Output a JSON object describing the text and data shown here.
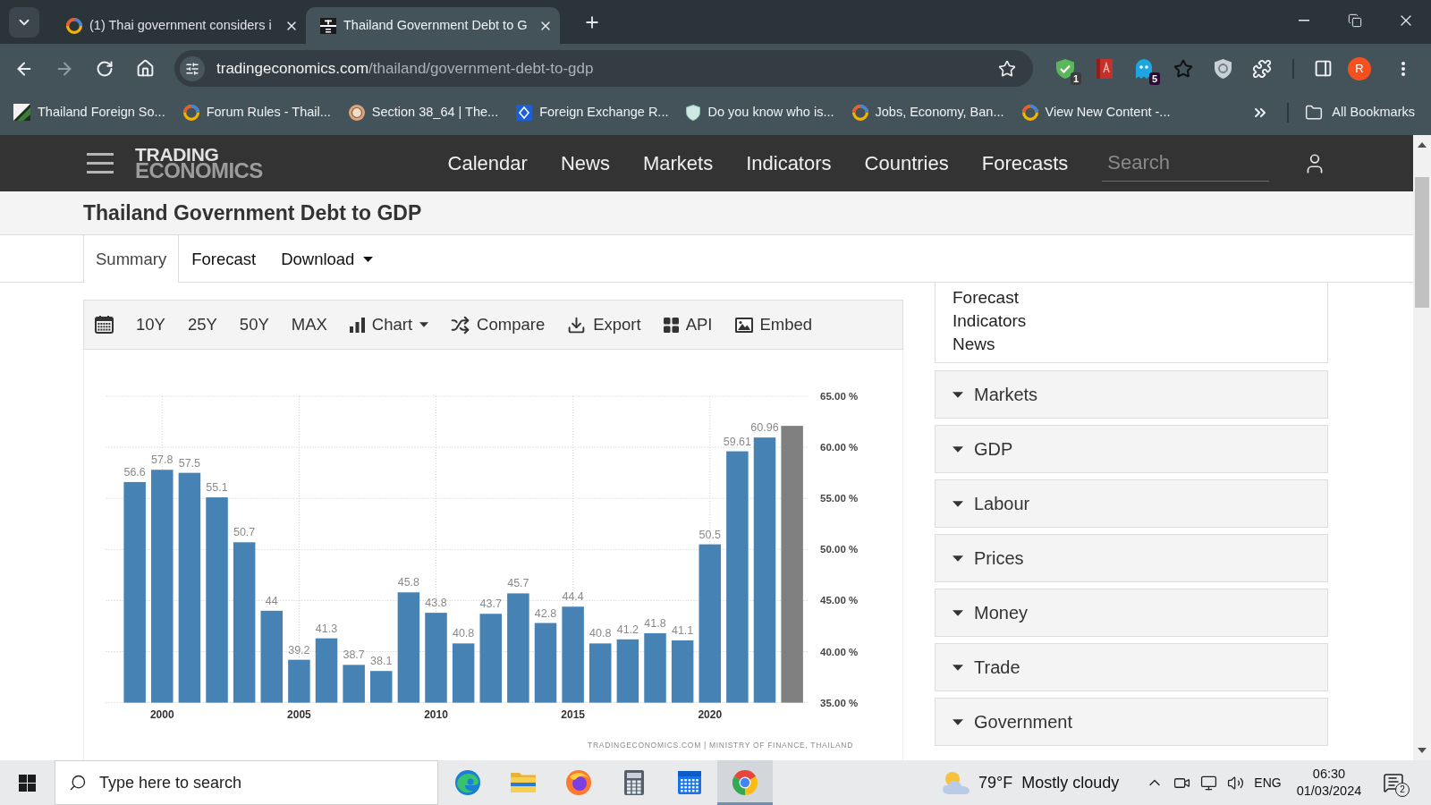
{
  "browser": {
    "tabs": [
      {
        "title": "(1) Thai government considers i",
        "kind": "ring",
        "selected": false
      },
      {
        "title": "Thailand Government Debt to G",
        "kind": "te",
        "selected": true
      }
    ],
    "address": {
      "domain": "tradingeconomics.com",
      "path": "/thailand/government-debt-to-gdp"
    },
    "extensions": [
      {
        "kind": "shield-check",
        "badge": "1"
      },
      {
        "kind": "book"
      },
      {
        "kind": "ghost",
        "badge": "5"
      },
      {
        "kind": "star"
      },
      {
        "kind": "shield"
      },
      {
        "kind": "puzzle"
      }
    ],
    "profile_initial": "R",
    "bookmarks": [
      {
        "label": "Thailand Foreign So...",
        "kind": "thumbnail"
      },
      {
        "label": "Forum Rules - Thail...",
        "kind": "ring"
      },
      {
        "label": "Section 38_64 | The...",
        "kind": "seal"
      },
      {
        "label": "Foreign Exchange R...",
        "kind": "diamond"
      },
      {
        "label": "Do you know who is...",
        "kind": "shield"
      },
      {
        "label": "Jobs, Economy, Ban...",
        "kind": "ring"
      },
      {
        "label": "View New Content -...",
        "kind": "ring"
      }
    ],
    "all_bookmarks": "All Bookmarks"
  },
  "site": {
    "logo": {
      "top": "TRADING",
      "bottom": "ECONOMICS"
    },
    "nav": [
      "Calendar",
      "News",
      "Markets",
      "Indicators",
      "Countries",
      "Forecasts"
    ],
    "search": {
      "placeholder": "Search"
    },
    "page_title": "Thailand Government Debt to GDP",
    "tabs": [
      {
        "label": "Summary",
        "selected": true
      },
      {
        "label": "Forecast",
        "selected": false
      },
      {
        "label": "Download",
        "selected": false,
        "dropdown": true
      }
    ],
    "chart_toolbar": [
      {
        "kind": "calendar"
      },
      {
        "kind": "period",
        "label": "10Y"
      },
      {
        "kind": "period",
        "label": "25Y"
      },
      {
        "kind": "period",
        "label": "50Y"
      },
      {
        "kind": "period",
        "label": "MAX"
      },
      {
        "kind": "bars",
        "label": "Chart",
        "dropdown": true
      },
      {
        "kind": "shuffle",
        "label": "Compare"
      },
      {
        "kind": "download",
        "label": "Export"
      },
      {
        "kind": "grid",
        "label": "API"
      },
      {
        "kind": "image",
        "label": "Embed"
      }
    ],
    "chart": {
      "chart_data": {
        "type": "bar",
        "x": [
          1999,
          2000,
          2001,
          2002,
          2003,
          2004,
          2005,
          2006,
          2007,
          2008,
          2009,
          2010,
          2011,
          2012,
          2013,
          2014,
          2015,
          2016,
          2017,
          2018,
          2019,
          2020,
          2021,
          2022,
          2023
        ],
        "series": [
          {
            "color": "#4682b4",
            "values": [
              56.6,
              57.8,
              57.5,
              55.1,
              50.7,
              44,
              39.2,
              41.3,
              38.7,
              38.1,
              45.8,
              43.8,
              40.8,
              43.7,
              45.7,
              42.8,
              44.4,
              40.8,
              41.2,
              41.8,
              41.1,
              50.5,
              59.61,
              60.96,
              null
            ]
          },
          {
            "color": "#808080",
            "values": [
              null,
              null,
              null,
              null,
              null,
              null,
              null,
              null,
              null,
              null,
              null,
              null,
              null,
              null,
              null,
              null,
              null,
              null,
              null,
              null,
              null,
              null,
              null,
              null,
              62.1
            ]
          }
        ],
        "stacked": true,
        "value_labels": [
          "56.6",
          "57.8",
          "57.5",
          "55.1",
          "50.7",
          "44",
          "39.2",
          "41.3",
          "38.7",
          "38.1",
          "45.8",
          "43.8",
          "40.8",
          "43.7",
          "45.7",
          "42.8",
          "44.4",
          "40.8",
          "41.2",
          "41.8",
          "41.1",
          "50.5",
          "59.61",
          "60.96"
        ],
        "xlim": [
          1997.95,
          2023.6
        ],
        "ylim": [
          35,
          65
        ],
        "yticks": [
          {
            "value": 35,
            "label": "35.00 %"
          },
          {
            "value": 40,
            "label": "40.00 %"
          },
          {
            "value": 45,
            "label": "45.00 %"
          },
          {
            "value": 50,
            "label": "50.00 %"
          },
          {
            "value": 55,
            "label": "55.00 %"
          },
          {
            "value": 60,
            "label": "60.00 %"
          },
          {
            "value": 65,
            "label": "65.00 %"
          }
        ],
        "xticks": [
          2000,
          2005,
          2010,
          2015,
          2020
        ],
        "grid": true
      },
      "source": "TRADINGECONOMICS.COM | MINISTRY OF FINANCE, THAILAND"
    },
    "sidebar": {
      "links": [
        "Forecast",
        "Indicators",
        "News"
      ],
      "sections": [
        "Markets",
        "GDP",
        "Labour",
        "Prices",
        "Money",
        "Trade",
        "Government"
      ]
    }
  },
  "taskbar": {
    "search": {
      "placeholder": "Type here to search"
    },
    "apps": [
      {
        "kind": "edge",
        "selected": false
      },
      {
        "kind": "explorer",
        "selected": false
      },
      {
        "kind": "firefox",
        "selected": false
      },
      {
        "kind": "calculator",
        "selected": false
      },
      {
        "kind": "calendar",
        "selected": false
      },
      {
        "kind": "chrome",
        "selected": true
      }
    ],
    "weather": {
      "temperature": "79°F",
      "condition": "Mostly cloudy"
    },
    "language": "ENG",
    "time": "06:30",
    "date": "01/03/2024",
    "notification_count": "2"
  }
}
